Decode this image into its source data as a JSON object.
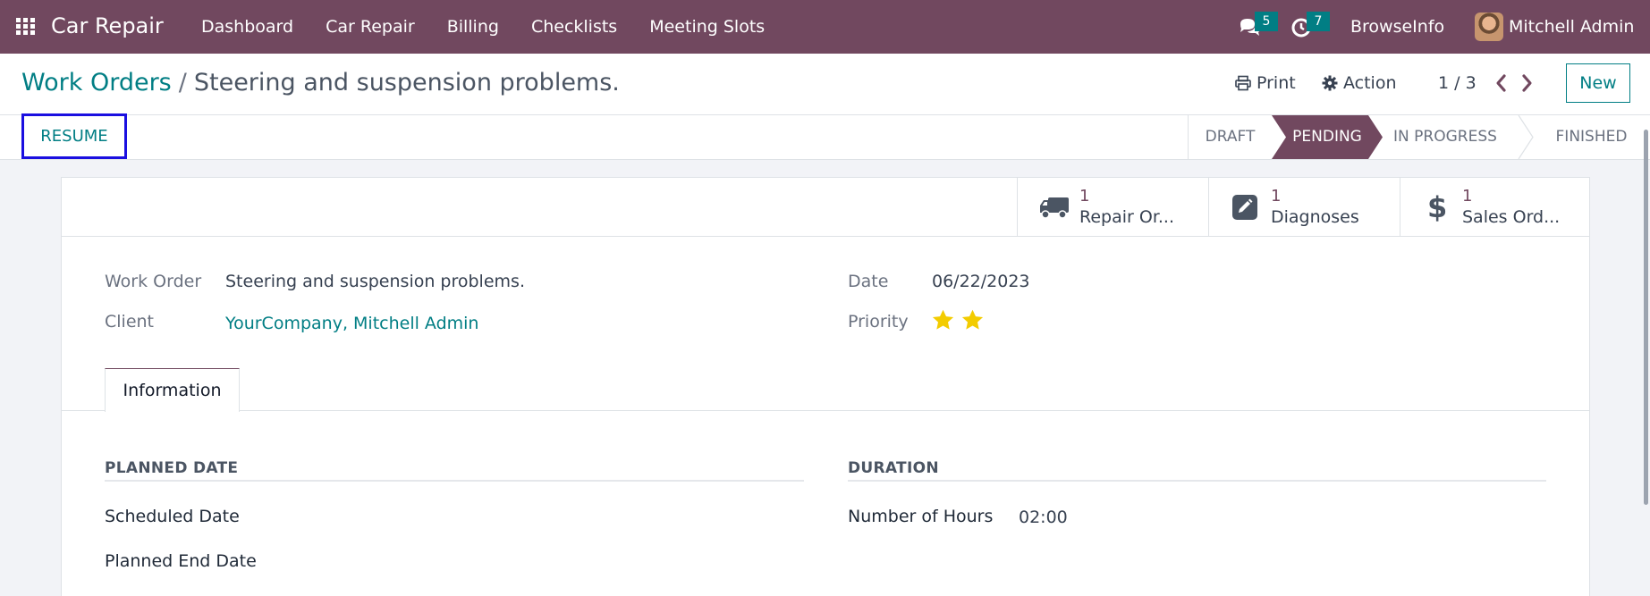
{
  "navbar": {
    "brand": "Car Repair",
    "menu": [
      "Dashboard",
      "Car Repair",
      "Billing",
      "Checklists",
      "Meeting Slots"
    ],
    "messages_count": "5",
    "activities_count": "7",
    "company": "BrowseInfo",
    "user": "Mitchell Admin"
  },
  "control_panel": {
    "breadcrumb_parent": "Work Orders",
    "breadcrumb_separator": "/",
    "breadcrumb_current": "Steering and suspension problems.",
    "print_label": "Print",
    "action_label": "Action",
    "pager": "1 / 3",
    "new_label": "New"
  },
  "statusbar": {
    "resume_label": "RESUME",
    "stages": [
      "DRAFT",
      "PENDING",
      "IN PROGRESS",
      "FINISHED"
    ],
    "current_stage": "PENDING"
  },
  "smart_buttons": [
    {
      "value": "1",
      "label": "Repair Or...",
      "icon": "truck-icon"
    },
    {
      "value": "1",
      "label": "Diagnoses",
      "icon": "edit-icon"
    },
    {
      "value": "1",
      "label": "Sales Ord...",
      "icon": "dollar-icon"
    }
  ],
  "form": {
    "work_order_label": "Work Order",
    "work_order_value": "Steering and suspension problems.",
    "client_label": "Client",
    "client_value": "YourCompany, Mitchell Admin",
    "date_label": "Date",
    "date_value": "06/22/2023",
    "priority_label": "Priority",
    "priority_stars": 2
  },
  "tabs": [
    "Information"
  ],
  "information": {
    "planned_date_title": "PLANNED DATE",
    "scheduled_date_label": "Scheduled Date",
    "planned_end_date_label": "Planned End Date",
    "duration_title": "DURATION",
    "hours_label": "Number of Hours",
    "hours_value": "02:00"
  },
  "colors": {
    "brand": "#71485f",
    "accent": "#017e84",
    "highlight_border": "#1a0fe0",
    "star": "#f3cc00"
  }
}
